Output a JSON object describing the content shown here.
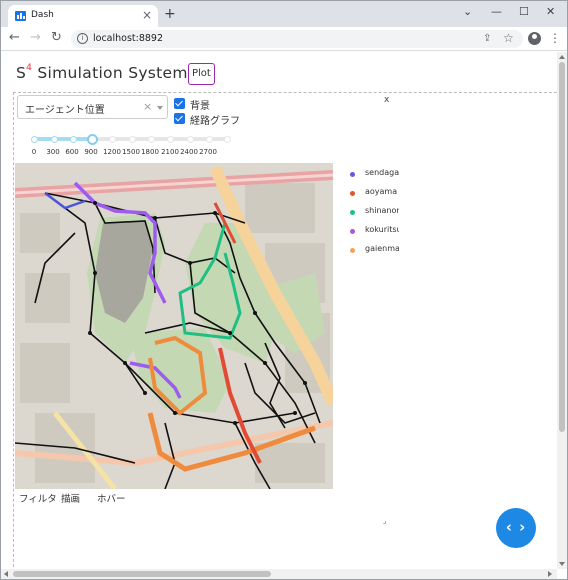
{
  "browser": {
    "tab_title": "Dash",
    "tab_close": "×",
    "new_tab": "+",
    "minimize": "⌄",
    "min_btn": "—",
    "max_btn": "☐",
    "close_btn": "✕",
    "back": "←",
    "forward": "→",
    "reload": "↻",
    "url": "localhost:8892",
    "info": "i",
    "share": "⇪",
    "star": "☆",
    "menu": "⋮"
  },
  "app": {
    "title_main": "S",
    "title_sup": "4",
    "title_rest": " Simulation System",
    "plot_tab": "Plot"
  },
  "controls": {
    "dropdown_value": "エージェント位置",
    "dropdown_clear": "×",
    "checkboxes": [
      {
        "label": "背景",
        "checked": true
      },
      {
        "label": "経路グラフ",
        "checked": true
      }
    ],
    "close_label": "x",
    "slider": {
      "marks": [
        "0",
        "300",
        "600",
        "900",
        "1200",
        "1500",
        "1800",
        "2100",
        "2400",
        "2700"
      ],
      "value": "900"
    }
  },
  "legend": [
    {
      "label": "sendagaya",
      "color": "#6457e0"
    },
    {
      "label": "aoyama",
      "color": "#e4532b"
    },
    {
      "label": "shinanomachi",
      "color": "#1dbf8e"
    },
    {
      "label": "kokuritsu",
      "color": "#a55bd9"
    },
    {
      "label": "gaienmae",
      "color": "#f5a25a"
    }
  ],
  "bottom_tabs": [
    "フィルタ",
    "描画",
    "ホバー"
  ],
  "resize_mark": "⌟",
  "fab_label": "‹ ›",
  "route_colors": {
    "kokuritsu": "#9d5ced",
    "shinanomachi": "#1fbf84",
    "gaienmae": "#f08a3c",
    "aoyama": "#e24a33",
    "sendagaya": "#4a55d6"
  }
}
